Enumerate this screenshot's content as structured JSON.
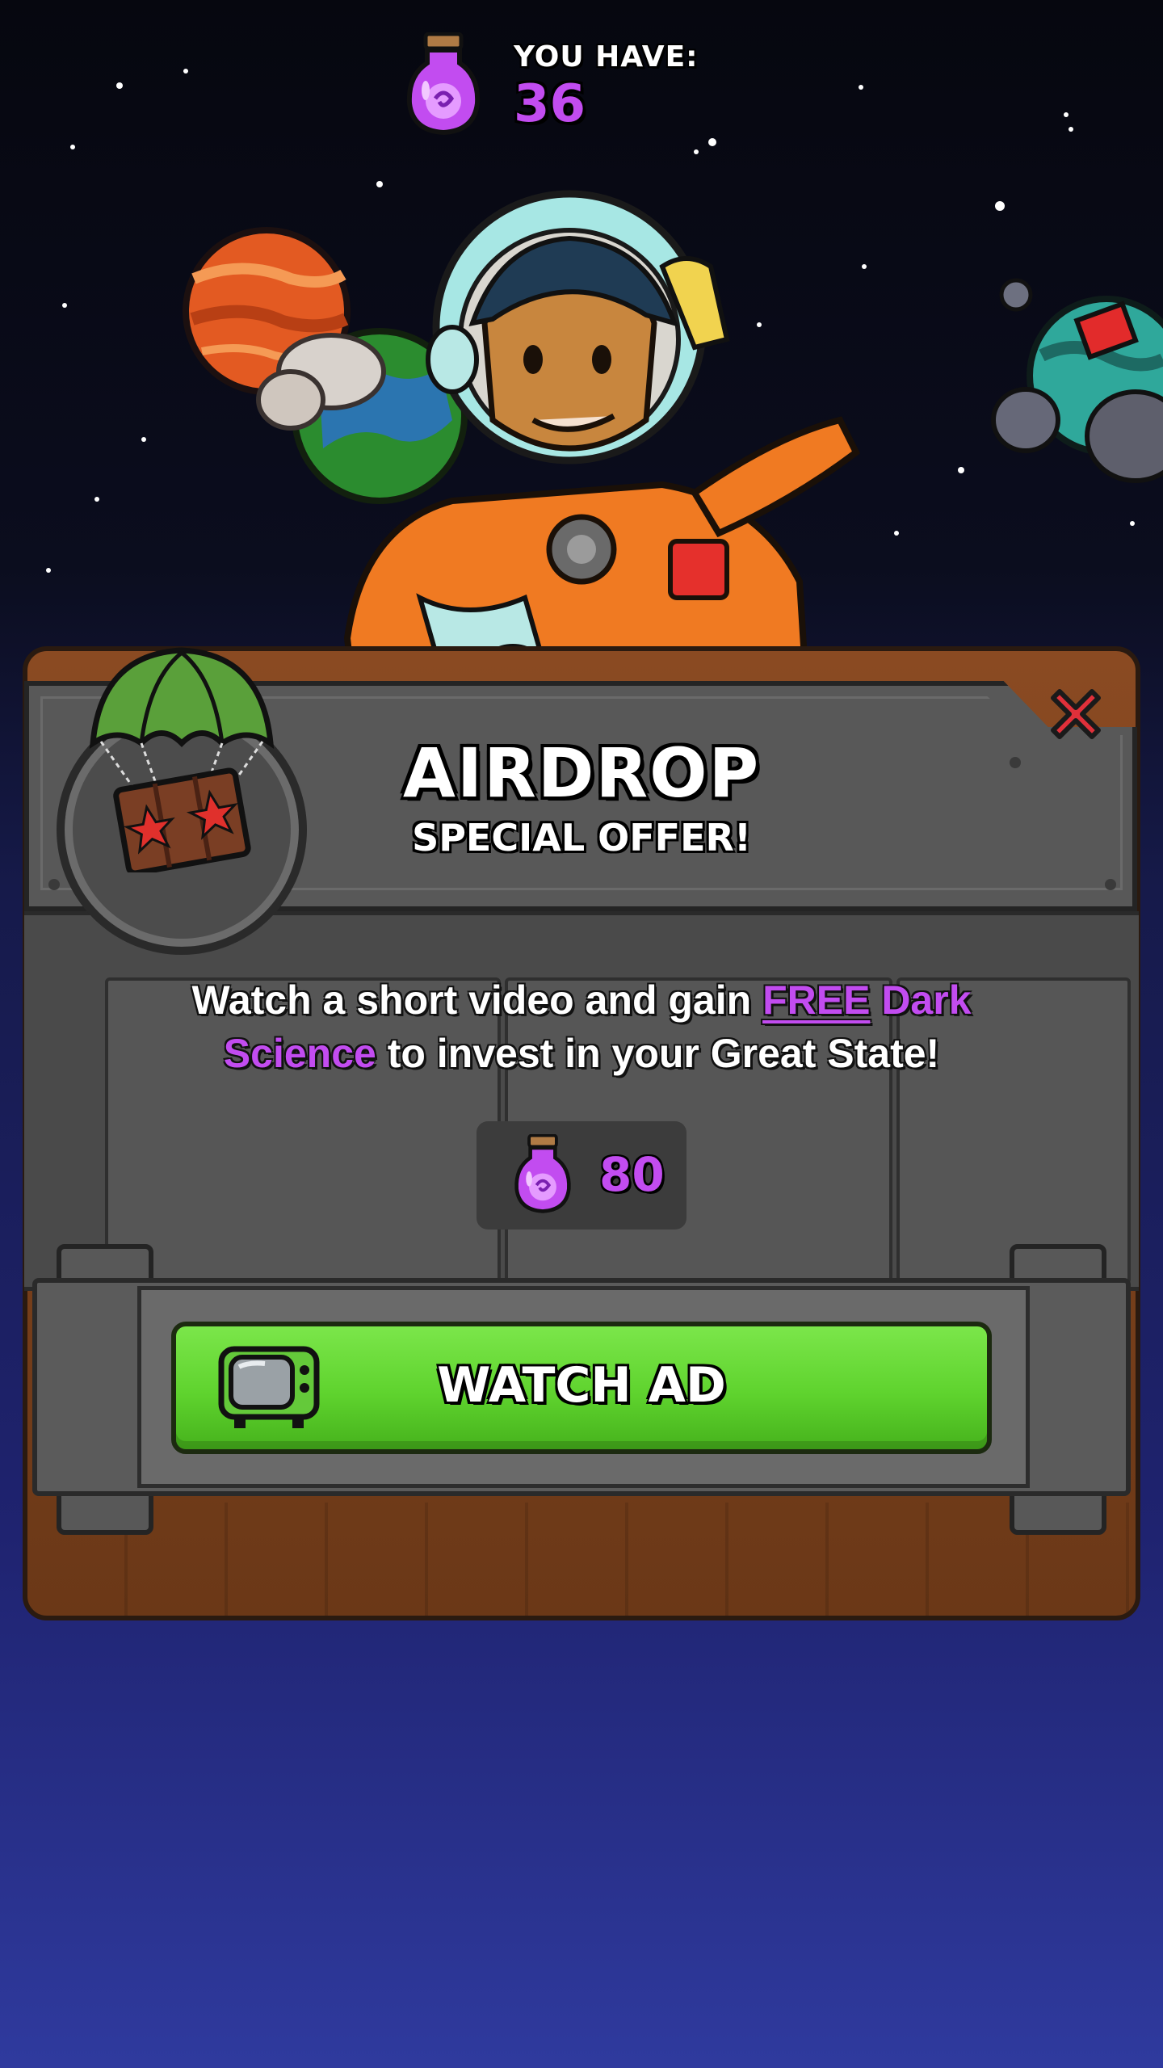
{
  "wallet": {
    "label": "YOU HAVE:",
    "amount": "36",
    "icon": "dark-science-jar-icon"
  },
  "offer": {
    "title": "AIRDROP",
    "subtitle": "SPECIAL OFFER!",
    "description_part1": "Watch a short video and gain ",
    "description_free": "FREE",
    "description_highlight": " Dark Science",
    "description_part2": " to invest in your Great State!",
    "reward_amount": "80",
    "reward_icon": "dark-science-jar-icon",
    "badge_icon": "parachute-crate-icon"
  },
  "actions": {
    "watch_ad_label": "WATCH AD",
    "watch_ad_icon": "tv-icon",
    "close_icon": "close-icon"
  },
  "colors": {
    "accent_purple": "#c24cf0",
    "button_green": "#5fd32e",
    "close_red": "#e0303a",
    "panel_wood": "#7a4220",
    "panel_metal": "#585858"
  }
}
